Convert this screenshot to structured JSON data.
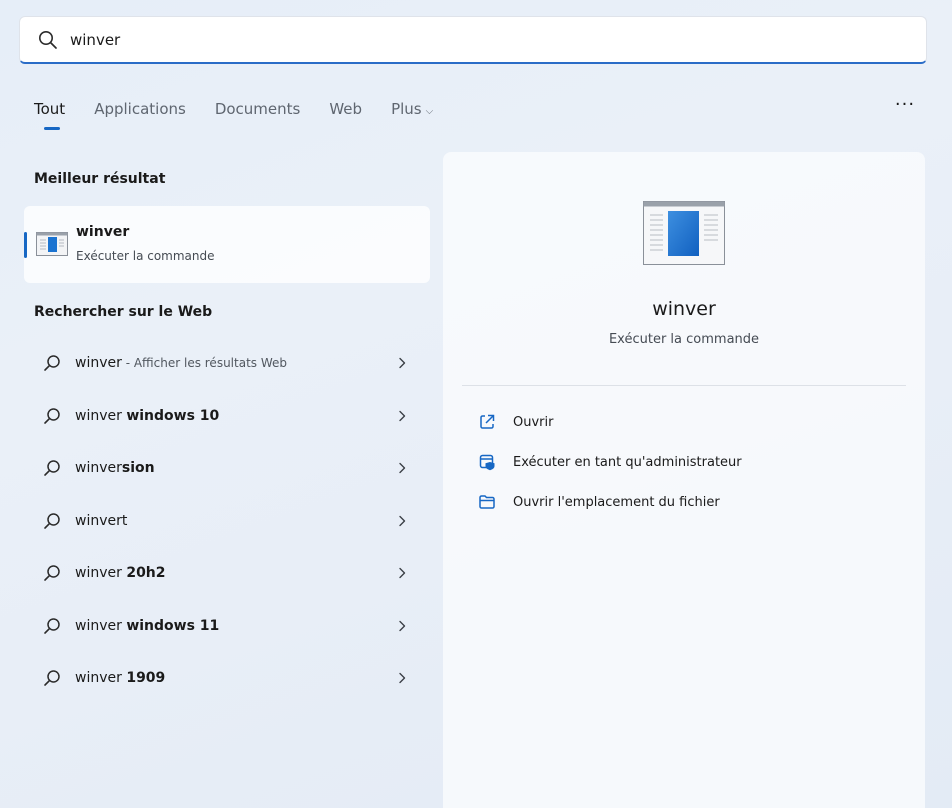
{
  "search": {
    "value": "winver",
    "icon": "search-icon"
  },
  "tabs": [
    {
      "label": "Tout",
      "active": true
    },
    {
      "label": "Applications"
    },
    {
      "label": "Documents"
    },
    {
      "label": "Web"
    },
    {
      "label": "Plus",
      "chevron": "⌵"
    }
  ],
  "more_label": "···",
  "best": {
    "heading": "Meilleur résultat",
    "title": "winver",
    "subtitle": "Exécuter la commande"
  },
  "web": {
    "heading": "Rechercher sur le Web",
    "items": [
      {
        "prefix": "winver",
        "bold": "",
        "hint": " - Afficher les résultats Web"
      },
      {
        "prefix": "winver ",
        "bold": "windows 10",
        "hint": ""
      },
      {
        "prefix": "winver",
        "bold": "sion",
        "hint": ""
      },
      {
        "prefix": "winvert",
        "bold": "",
        "hint": ""
      },
      {
        "prefix": "winver ",
        "bold": "20h2",
        "hint": ""
      },
      {
        "prefix": "winver ",
        "bold": "windows 11",
        "hint": ""
      },
      {
        "prefix": "winver ",
        "bold": "1909",
        "hint": ""
      }
    ]
  },
  "detail": {
    "title": "winver",
    "subtitle": "Exécuter la commande",
    "actions": [
      {
        "label": "Ouvrir",
        "icon": "open-external-icon"
      },
      {
        "label": "Exécuter en tant qu'administrateur",
        "icon": "admin-shield-icon"
      },
      {
        "label": "Ouvrir l'emplacement du fichier",
        "icon": "folder-icon"
      }
    ]
  },
  "colors": {
    "accent": "#1667c4"
  }
}
